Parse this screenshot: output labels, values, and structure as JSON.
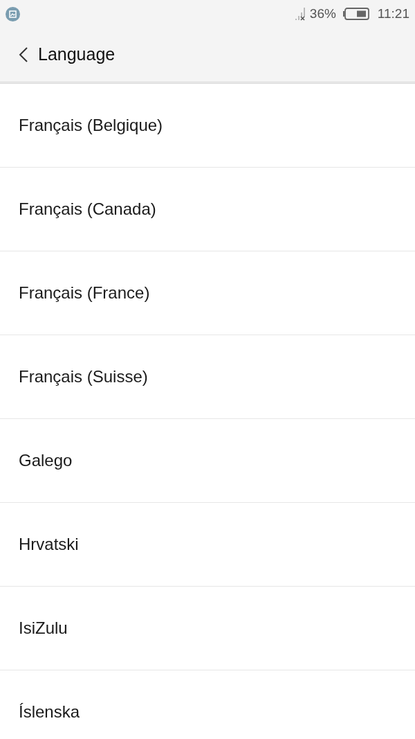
{
  "status_bar": {
    "battery_percent": "36%",
    "time": "11:21"
  },
  "header": {
    "title": "Language"
  },
  "languages": [
    "Français (Belgique)",
    "Français (Canada)",
    "Français (France)",
    "Français (Suisse)",
    "Galego",
    "Hrvatski",
    "IsiZulu",
    "Íslenska"
  ]
}
